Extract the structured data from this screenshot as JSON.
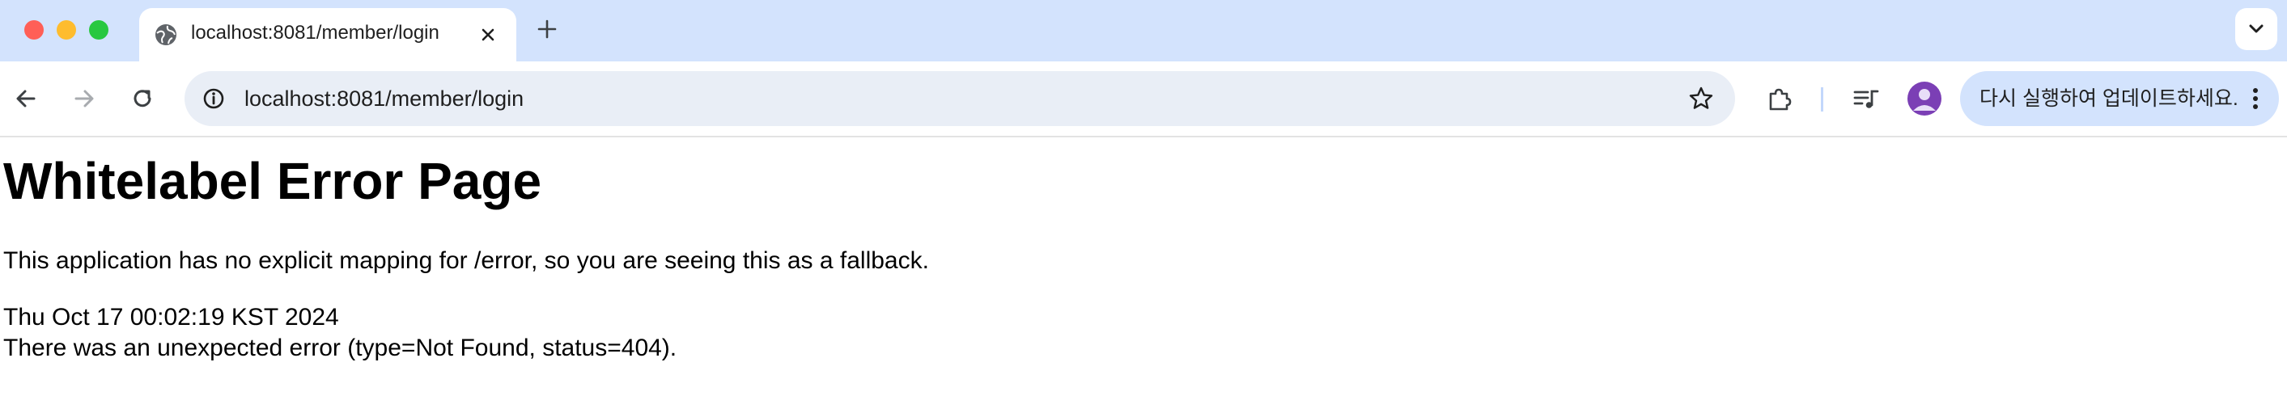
{
  "browser": {
    "tab": {
      "title": "localhost:8081/member/login"
    },
    "toolbar": {
      "url": "localhost:8081/member/login",
      "update_button_label": "다시 실행하여 업데이트하세요."
    },
    "icons": {
      "tab_favicon": "globe-icon",
      "tab_close": "close-icon",
      "new_tab": "plus-icon",
      "tab_search": "chevron-down-icon",
      "back": "arrow-left-icon",
      "forward": "arrow-right-icon",
      "reload": "reload-icon",
      "site_info": "info-icon",
      "bookmark": "star-icon",
      "extensions": "puzzle-icon",
      "media": "media-queue-icon",
      "profile": "avatar-icon",
      "menu": "more-vertical-icon"
    },
    "colors": {
      "tabstrip_bg": "#d3e3fd",
      "omnibox_bg": "#e9eef6",
      "avatar_bg": "#7b3fb5",
      "traffic_close": "#ff5f57",
      "traffic_minimize": "#febc2e",
      "traffic_maximize": "#28c840"
    }
  },
  "page": {
    "title": "Whitelabel Error Page",
    "message": "This application has no explicit mapping for /error, so you are seeing this as a fallback.",
    "timestamp": "Thu Oct 17 00:02:19 KST 2024",
    "error": "There was an unexpected error (type=Not Found, status=404)."
  }
}
